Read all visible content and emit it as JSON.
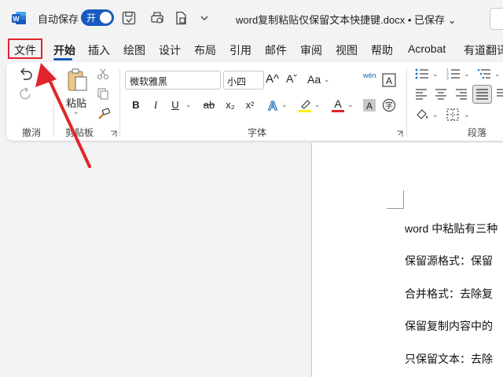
{
  "titlebar": {
    "autosave_label": "自动保存",
    "autosave_toggle": "开",
    "doc_title": "word复制粘贴仅保留文本快捷键.docx • 已保存 ⌄"
  },
  "tabs": [
    {
      "label": "文件"
    },
    {
      "label": "开始"
    },
    {
      "label": "插入"
    },
    {
      "label": "绘图"
    },
    {
      "label": "设计"
    },
    {
      "label": "布局"
    },
    {
      "label": "引用"
    },
    {
      "label": "邮件"
    },
    {
      "label": "审阅"
    },
    {
      "label": "视图"
    },
    {
      "label": "帮助"
    },
    {
      "label": "Acrobat"
    },
    {
      "label": "有道翻译"
    }
  ],
  "ribbon": {
    "undo_group_label": "撤消",
    "clipboard_group_label": "剪贴板",
    "paste_label": "粘贴",
    "font_group_label": "字体",
    "paragraph_group_label": "段落",
    "font_name": "微软雅黑",
    "font_size": "小四",
    "grow_font": "A^",
    "shrink_font": "Aˇ",
    "change_case": "Aa",
    "phonetic": "wén",
    "bold": "B",
    "italic": "I",
    "underline": "U",
    "strikethrough": "ab",
    "subscript": "x₂",
    "superscript": "x²"
  },
  "document": {
    "lines": [
      "word 中粘贴有三种",
      "保留源格式：保留",
      "合并格式：去除复",
      "保留复制内容中的",
      "只保留文本：去除"
    ]
  },
  "colors": {
    "accent": "#185abd",
    "highlight_red": "#e0262b",
    "highlighter_yellow": "#ffef00",
    "font_color_red": "#e0262b"
  }
}
